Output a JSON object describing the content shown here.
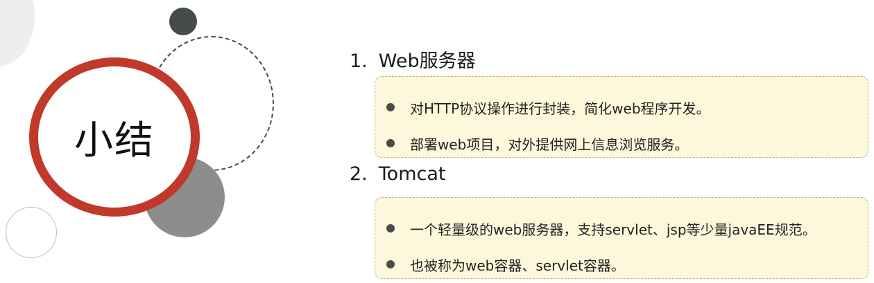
{
  "summary": {
    "title": "小结"
  },
  "sections": [
    {
      "number": "1.",
      "title": "Web服务器",
      "bullets": [
        "对HTTP协议操作进行封装，简化web程序开发。",
        "部署web项目，对外提供网上信息浏览服务。"
      ]
    },
    {
      "number": "2.",
      "title": "Tomcat",
      "bullets": [
        "一个轻量级的web服务器，支持servlet、jsp等少量javaEE规范。",
        "也被称为web容器、servlet容器。"
      ]
    }
  ],
  "colors": {
    "accent_ring": "#c0392b",
    "box_background": "#fdf8db",
    "box_border": "#b9b08a"
  }
}
